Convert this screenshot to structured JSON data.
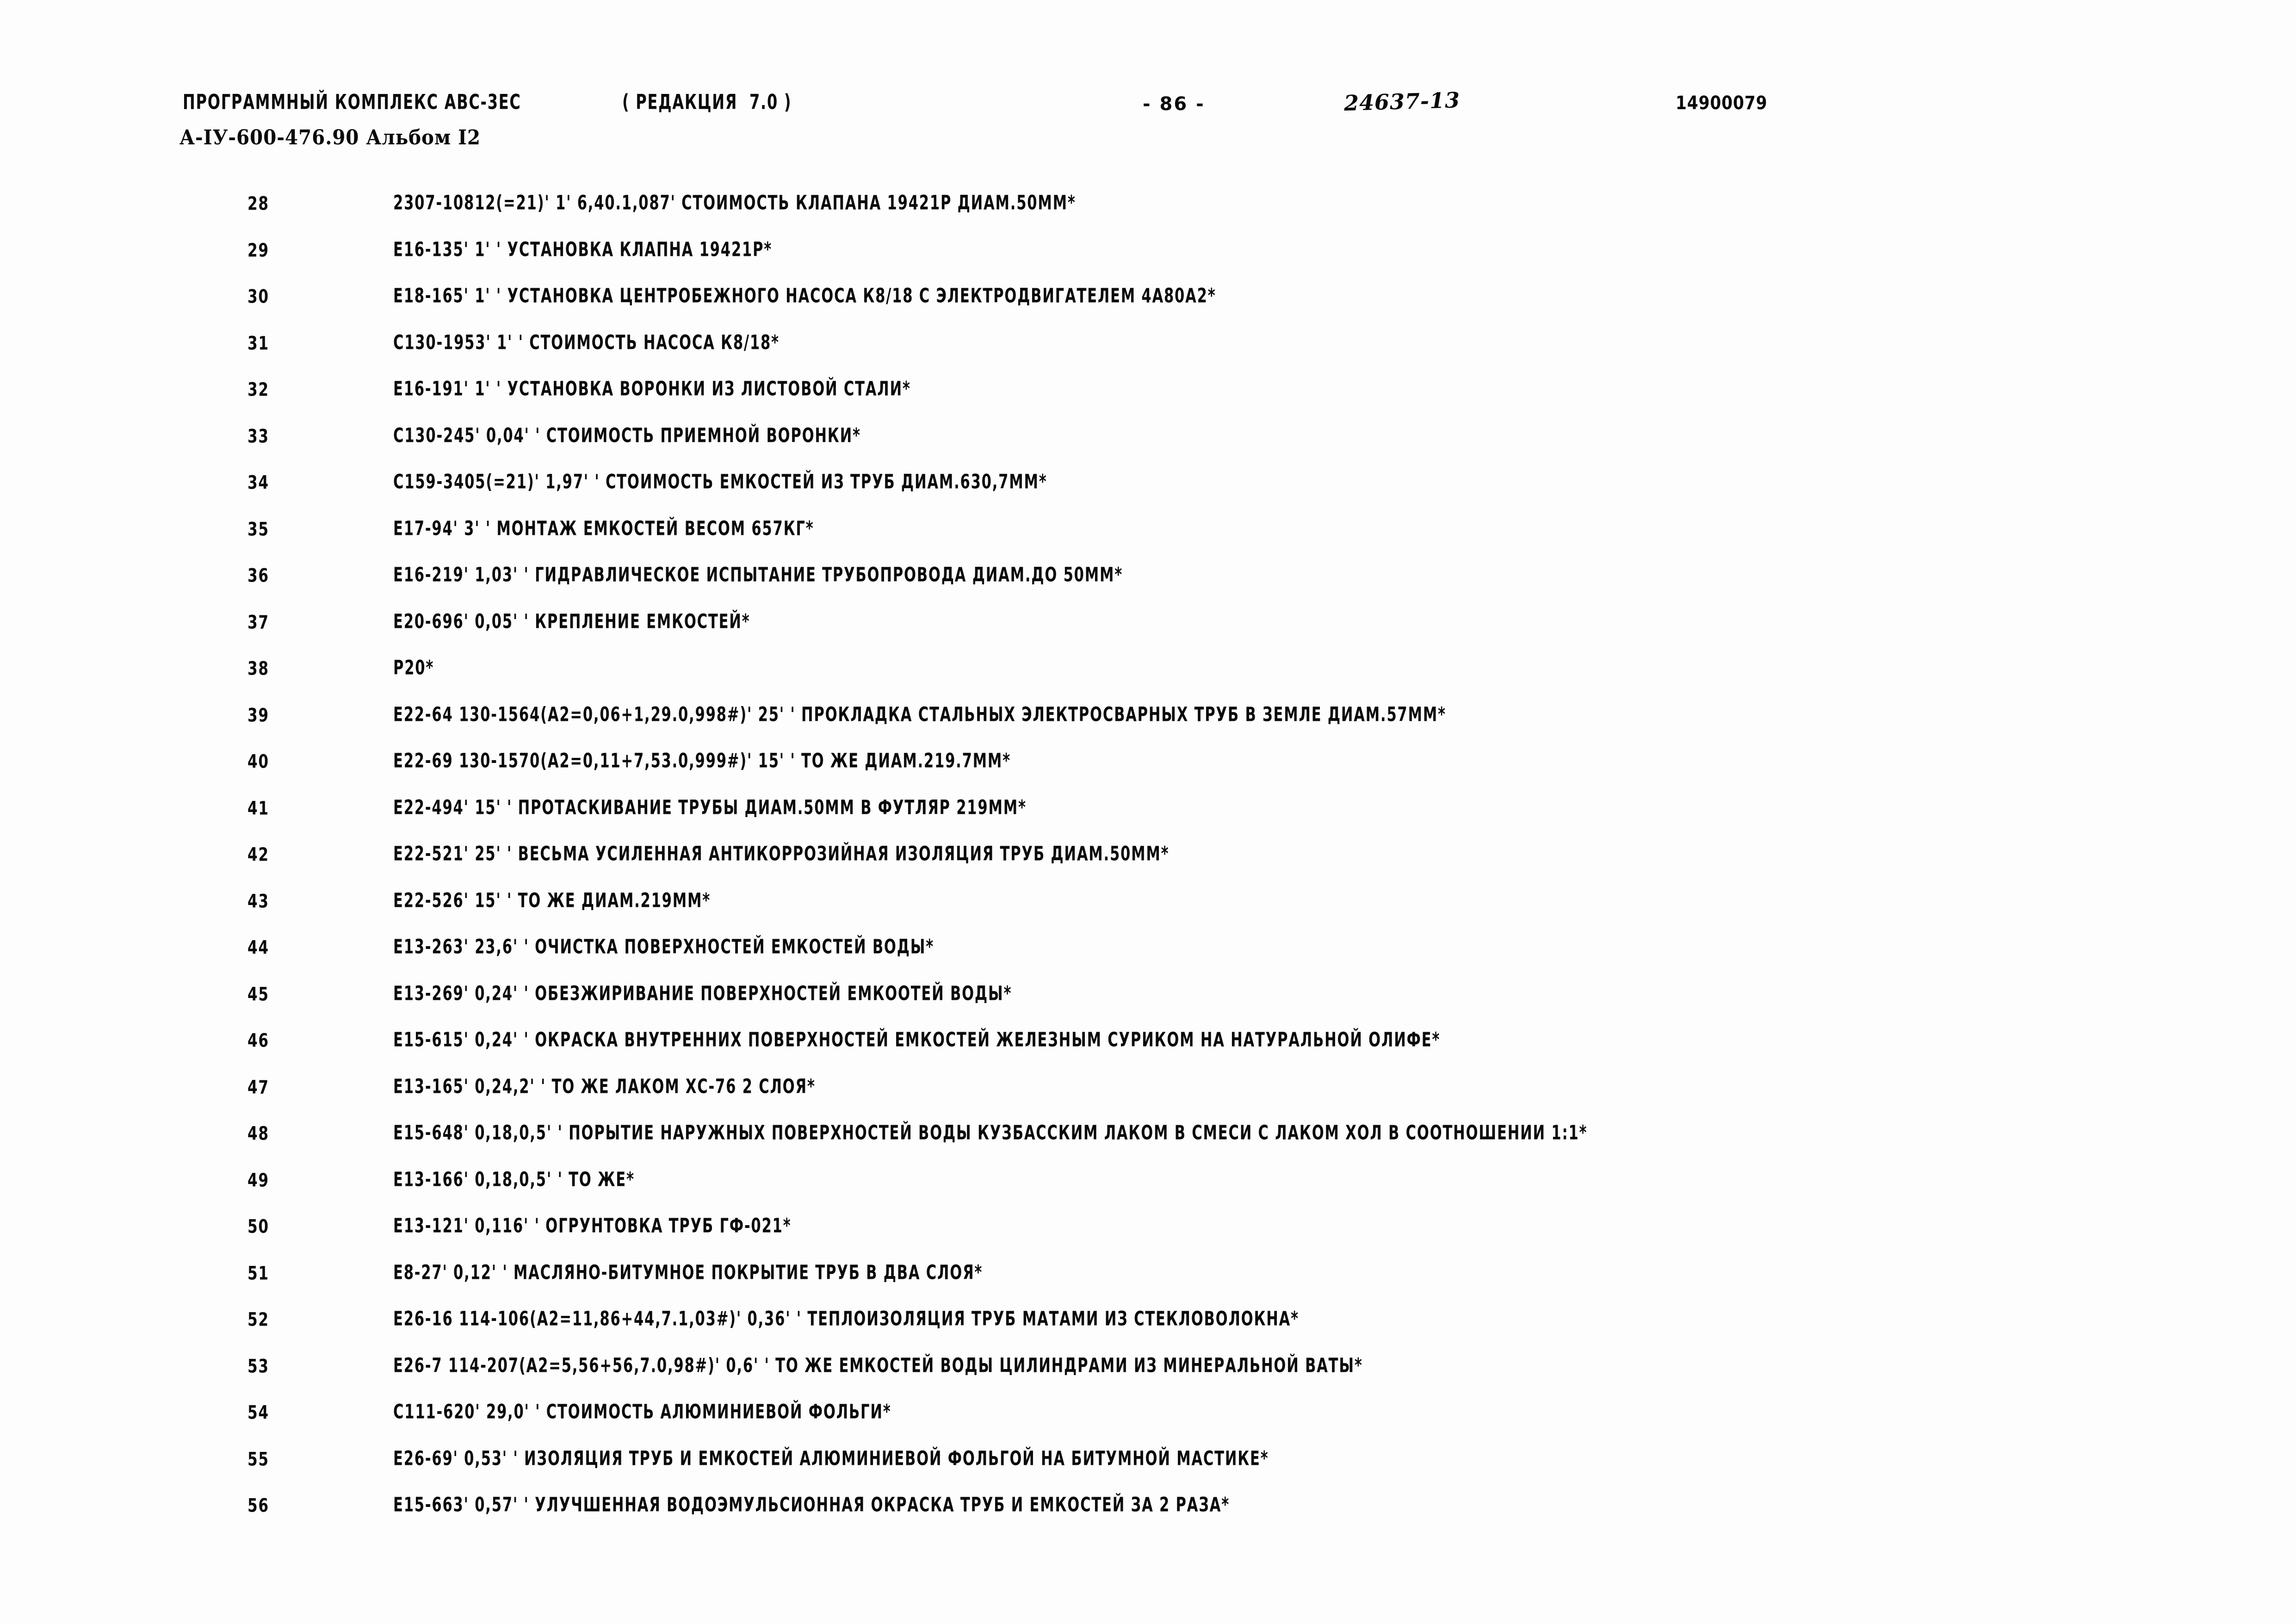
{
  "header": {
    "program_title": "ПРОГРАММНЫЙ КОМПЛЕКС АВС-3ЕС",
    "edition": "( РЕДАКЦИЯ  7.0 )",
    "document_code": "А-IУ-600-476.90 Альбом I2",
    "page_number": "- 86 -",
    "handwritten_stamp": "24637-13",
    "right_code": "14900079"
  },
  "listing": {
    "rows": [
      {
        "num": "28",
        "text": "2307-10812(=21)' 1' 6,40.1,087' СТОИМОСТЬ КЛАПАНА 19421Р ДИАМ.50ММ*"
      },
      {
        "num": "29",
        "text": "Е16-135' 1' ' УСТАНОВКА КЛАПНА 19421Р*"
      },
      {
        "num": "30",
        "text": "Е18-165' 1' ' УСТАНОВКА ЦЕНТРОБЕЖНОГО НАСОСА К8/18 С ЭЛЕКТРОДВИГАТЕЛЕМ 4А80А2*"
      },
      {
        "num": "31",
        "text": "С130-1953' 1' ' СТОИМОСТЬ НАСОСА К8/18*"
      },
      {
        "num": "32",
        "text": "Е16-191' 1' ' УСТАНОВКА ВОРОНКИ ИЗ ЛИСТОВОЙ СТАЛИ*"
      },
      {
        "num": "33",
        "text": "С130-245' 0,04' ' СТОИМОСТЬ ПРИЕМНОЙ ВОРОНКИ*"
      },
      {
        "num": "34",
        "text": "С159-3405(=21)' 1,97' ' СТОИМОСТЬ ЕМКОСТЕЙ ИЗ ТРУБ ДИАМ.630,7ММ*"
      },
      {
        "num": "35",
        "text": "Е17-94' 3' ' МОНТАЖ ЕМКОСТЕЙ ВЕСОМ 657КГ*"
      },
      {
        "num": "36",
        "text": "Е16-219' 1,03' ' ГИДРАВЛИЧЕСКОЕ ИСПЫТАНИЕ ТРУБОПРОВОДА ДИАМ.ДО 50ММ*"
      },
      {
        "num": "37",
        "text": "Е20-696' 0,05' ' КРЕПЛЕНИЕ ЕМКОСТЕЙ*"
      },
      {
        "num": "38",
        "text": "Р20*"
      },
      {
        "num": "39",
        "text": "Е22-64 130-1564(А2=0,06+1,29.0,998#)' 25' ' ПРОКЛАДКА СТАЛЬНЫХ ЭЛЕКТРОСВАРНЫХ ТРУБ В ЗЕМЛЕ ДИАМ.57ММ*"
      },
      {
        "num": "40",
        "text": "Е22-69 130-1570(А2=0,11+7,53.0,999#)' 15' ' ТО ЖЕ ДИАМ.219.7ММ*"
      },
      {
        "num": "41",
        "text": "Е22-494' 15' ' ПРОТАСКИВАНИЕ ТРУБЫ ДИАМ.50ММ В ФУТЛЯР 219ММ*"
      },
      {
        "num": "42",
        "text": "Е22-521' 25' ' ВЕСЬМА УСИЛЕННАЯ АНТИКОРРОЗИЙНАЯ ИЗОЛЯЦИЯ ТРУБ ДИАМ.50ММ*"
      },
      {
        "num": "43",
        "text": "Е22-526' 15' ' ТО ЖЕ ДИАМ.219ММ*"
      },
      {
        "num": "44",
        "text": "Е13-263' 23,6' ' ОЧИСТКА ПОВЕРХНОСТЕЙ ЕМКОСТЕЙ ВОДЫ*"
      },
      {
        "num": "45",
        "text": "Е13-269' 0,24' ' ОБЕЗЖИРИВАНИЕ ПОВЕРХНОСТЕЙ ЕМКООТЕЙ ВОДЫ*"
      },
      {
        "num": "46",
        "text": "Е15-615' 0,24' ' ОКРАСКА ВНУТРЕННИХ ПОВЕРХНОСТЕЙ ЕМКОСТЕЙ ЖЕЛЕЗНЫМ СУРИКОМ НА НАТУРАЛЬНОЙ ОЛИФЕ*"
      },
      {
        "num": "47",
        "text": "Е13-165' 0,24,2' ' ТО ЖЕ ЛАКОМ ХС-76 2 СЛОЯ*"
      },
      {
        "num": "48",
        "text": "Е15-648' 0,18,0,5' ' ПОРЫТИЕ НАРУЖНЫХ ПОВЕРХНОСТЕЙ ВОДЫ КУЗБАССКИМ ЛАКОМ В СМЕСИ С ЛАКОМ ХОЛ В СООТНОШЕНИИ 1:1*"
      },
      {
        "num": "49",
        "text": "Е13-166' 0,18,0,5' ' ТО ЖЕ*"
      },
      {
        "num": "50",
        "text": "Е13-121' 0,116' ' ОГРУНТОВКА ТРУБ ГФ-021*"
      },
      {
        "num": "51",
        "text": "Е8-27' 0,12' ' МАСЛЯНО-БИТУМНОЕ ПОКРЫТИЕ ТРУБ В ДВА СЛОЯ*"
      },
      {
        "num": "52",
        "text": "Е26-16 114-106(А2=11,86+44,7.1,03#)' 0,36' ' ТЕПЛОИЗОЛЯЦИЯ ТРУБ МАТАМИ ИЗ СТЕКЛОВОЛОКНА*"
      },
      {
        "num": "53",
        "text": "Е26-7 114-207(А2=5,56+56,7.0,98#)' 0,6' ' ТО ЖЕ ЕМКОСТЕЙ ВОДЫ ЦИЛИНДРАМИ ИЗ МИНЕРАЛЬНОЙ ВАТЫ*"
      },
      {
        "num": "54",
        "text": "С111-620' 29,0' ' СТОИМОСТЬ АЛЮМИНИЕВОЙ ФОЛЬГИ*"
      },
      {
        "num": "55",
        "text": "Е26-69' 0,53' ' ИЗОЛЯЦИЯ ТРУБ И ЕМКОСТЕЙ АЛЮМИНИЕВОЙ ФОЛЬГОЙ НА БИТУМНОЙ МАСТИКЕ*"
      },
      {
        "num": "56",
        "text": "Е15-663' 0,57' ' УЛУЧШЕННАЯ ВОДОЭМУЛЬСИОННАЯ ОКРАСКА ТРУБ И ЕМКОСТЕЙ ЗА 2 РАЗА*"
      }
    ]
  }
}
